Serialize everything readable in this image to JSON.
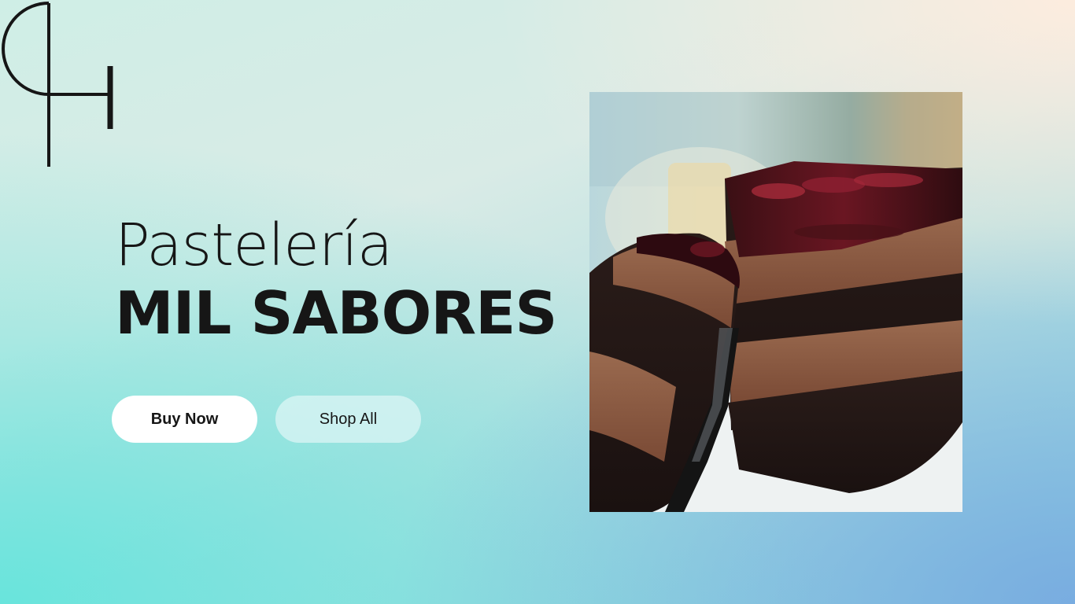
{
  "hero": {
    "subtitle": "Pastelería",
    "title": "MIL SABORES"
  },
  "buttons": {
    "buy_now": "Buy Now",
    "shop_all": "Shop All"
  },
  "logo": {
    "icon": "ph-monogram-logo"
  },
  "image": {
    "icon": "chocolate-cake-photo"
  },
  "colors": {
    "text": "#161616",
    "button_primary_bg": "#ffffff",
    "button_secondary_bg": "#d6f1f1"
  }
}
